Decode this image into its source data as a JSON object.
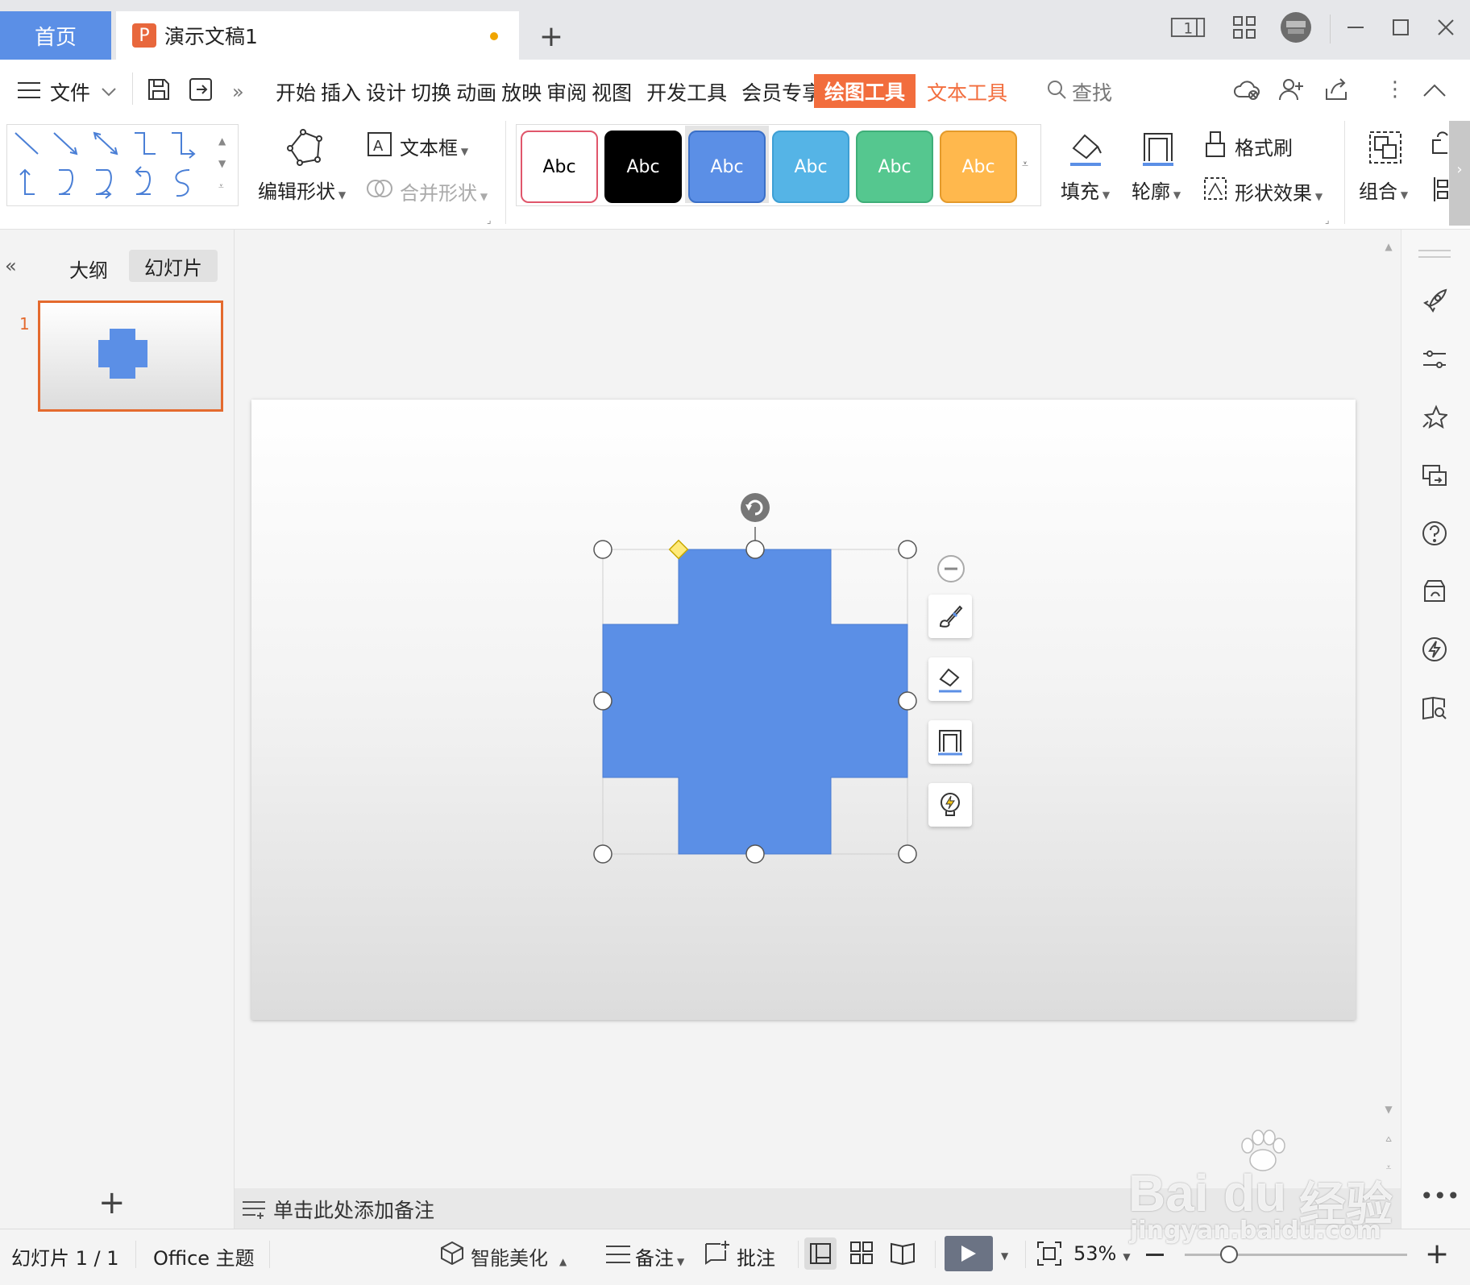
{
  "tabs": {
    "home": "首页",
    "document": "演示文稿1",
    "document_badge": "P",
    "new_tab": "+"
  },
  "window": {
    "layout_icon_text": "1"
  },
  "menu": {
    "file": "文件",
    "items": [
      "开始",
      "插入",
      "设计",
      "切换",
      "动画",
      "放映",
      "审阅",
      "视图",
      "开发工具",
      "会员专享"
    ],
    "active_context_tab": "绘图工具",
    "context_tab_2": "文本工具",
    "search": "查找"
  },
  "ribbon": {
    "edit_shape": "编辑形状",
    "text_box": "文本框",
    "merge_shape": "合并形状",
    "style_label": "Abc",
    "styles": [
      {
        "bg": "#ffffff",
        "fg": "#000000",
        "border": "#e0566b"
      },
      {
        "bg": "#000000",
        "fg": "#ffffff",
        "border": "#000000"
      },
      {
        "bg": "#5b8fe6",
        "fg": "#ffffff",
        "border": "#3a6fc7"
      },
      {
        "bg": "#55b4e6",
        "fg": "#ffffff",
        "border": "#3d9fd4"
      },
      {
        "bg": "#55c78f",
        "fg": "#ffffff",
        "border": "#3fae78"
      },
      {
        "bg": "#ffb84d",
        "fg": "#ffffff",
        "border": "#e49a2a"
      }
    ],
    "fill": "填充",
    "outline": "轮廓",
    "format_painter": "格式刷",
    "shape_effects": "形状效果",
    "group": "组合"
  },
  "left_panel": {
    "outline_tab": "大纲",
    "slides_tab": "幻灯片",
    "slide_number": "1",
    "add": "+"
  },
  "notes": {
    "placeholder": "单击此处添加备注"
  },
  "status": {
    "slide_info": "幻灯片 1 / 1",
    "theme": "Office 主题",
    "beautify": "智能美化",
    "notes": "备注",
    "comments": "批注",
    "zoom": "53%",
    "zoom_level_percent": 53
  },
  "watermark": {
    "brand_a": "Bai",
    "brand_b": "du",
    "brand_c": "经验",
    "url": "jingyan.baidu.com"
  },
  "colors": {
    "accent": "#5b8fe6",
    "context_tab": "#f26d3d",
    "shape_fill": "#5b8fe6",
    "thumb_border": "#e46a2e"
  }
}
